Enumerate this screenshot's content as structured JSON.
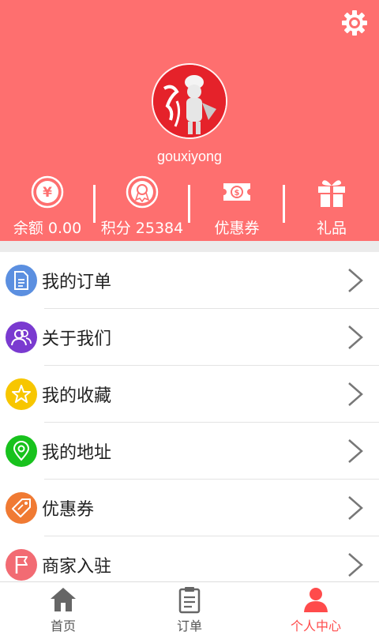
{
  "header": {
    "username": "gouxiyong",
    "colors": {
      "background": "#fe6f6f",
      "avatar": "#e5222a"
    }
  },
  "stats": [
    {
      "label": "余额 0.00",
      "icon": "yuan-coin-icon"
    },
    {
      "label": "积分 25384",
      "icon": "badge-medal-icon"
    },
    {
      "label": "优惠券",
      "icon": "coupon-ticket-icon"
    },
    {
      "label": "礼品",
      "icon": "gift-icon"
    }
  ],
  "menu": [
    {
      "label": "我的订单",
      "icon": "document-icon",
      "color": "#5b8fe0"
    },
    {
      "label": "关于我们",
      "icon": "users-icon",
      "color": "#7a3ad0"
    },
    {
      "label": "我的收藏",
      "icon": "star-icon",
      "color": "#f7c600"
    },
    {
      "label": "我的地址",
      "icon": "location-pin-icon",
      "color": "#18c21d"
    },
    {
      "label": "优惠券",
      "icon": "tag-icon",
      "color": "#f07a33"
    },
    {
      "label": "商家入驻",
      "icon": "flag-icon",
      "color": "#f26b73"
    }
  ],
  "tabs": [
    {
      "label": "首页",
      "icon": "home-icon",
      "active": false
    },
    {
      "label": "订单",
      "icon": "clipboard-icon",
      "active": false
    },
    {
      "label": "个人中心",
      "icon": "person-icon",
      "active": true
    }
  ],
  "accent": "#ff4b4b"
}
